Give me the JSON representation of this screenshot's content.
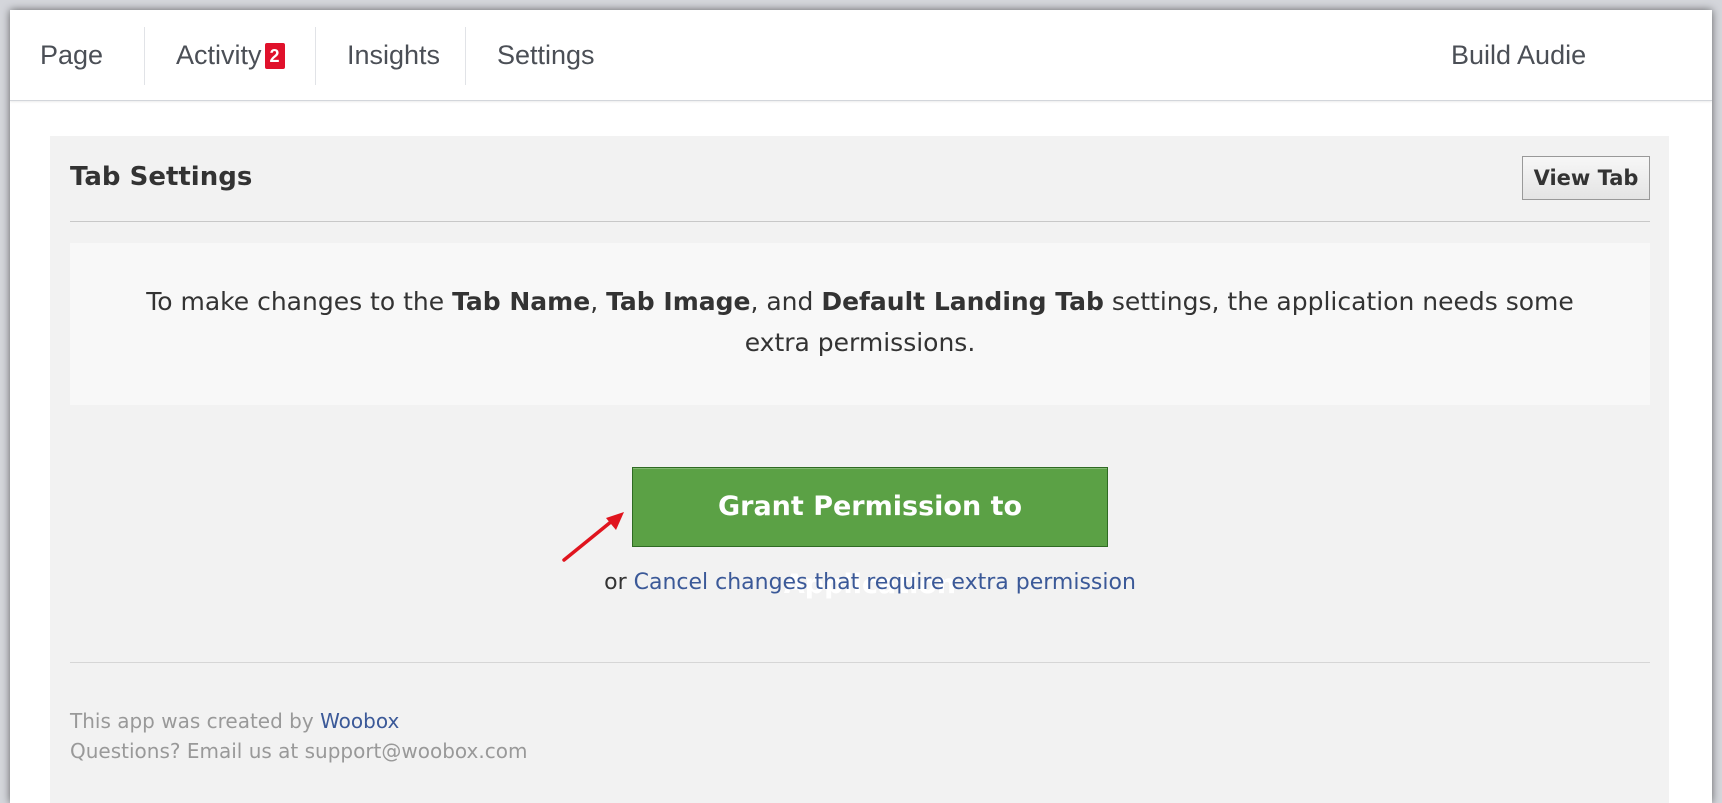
{
  "nav": {
    "page": "Page",
    "activity": "Activity",
    "activity_badge": "2",
    "insights": "Insights",
    "settings": "Settings",
    "build_audience": "Build Audie"
  },
  "panel": {
    "title": "Tab Settings",
    "view_tab_label": "View Tab"
  },
  "notice": {
    "text_1": "To make changes to the ",
    "bold_1": "Tab Name",
    "text_2": ", ",
    "bold_2": "Tab Image",
    "text_3": ", and ",
    "bold_3": "Default Landing Tab",
    "text_4": " settings, the application needs some extra permissions."
  },
  "actions": {
    "grant_label": "Grant Permission to Application",
    "or_text": "or ",
    "cancel_label": "Cancel changes that require extra permission"
  },
  "footer": {
    "created_by_text": "This app was created by ",
    "creator_link": "Woobox",
    "questions_text": "Questions? Email us at support@woobox.com"
  },
  "colors": {
    "badge": "#e0112b",
    "grant_button": "#5ba145",
    "link": "#3b5998",
    "arrow": "#e0141e"
  }
}
